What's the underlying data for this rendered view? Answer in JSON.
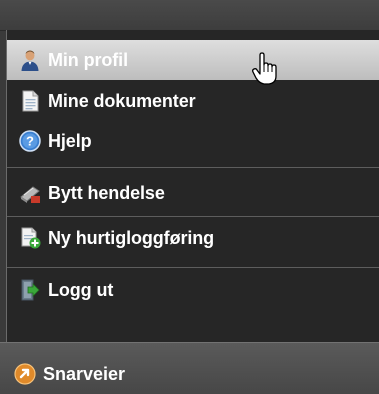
{
  "menu": {
    "items": [
      {
        "label": "Min profil",
        "icon": "user-icon",
        "active": true
      },
      {
        "label": "Mine dokumenter",
        "icon": "document-icon"
      },
      {
        "label": "Hjelp",
        "icon": "help-icon"
      },
      {
        "label": "Bytt hendelse",
        "icon": "switch-event-icon"
      },
      {
        "label": "Ny hurtigloggføring",
        "icon": "new-quick-log-icon"
      },
      {
        "label": "Logg ut",
        "icon": "logout-icon"
      }
    ]
  },
  "bottom": {
    "label": "Snarveier",
    "icon": "shortcuts-icon"
  },
  "colors": {
    "menu_bg": "#262626",
    "active_bg": "#cfcfcf",
    "text": "#ffffff",
    "help_blue": "#3a7fd0",
    "shortcut_orange": "#e08a2a",
    "green": "#3aa83a"
  }
}
